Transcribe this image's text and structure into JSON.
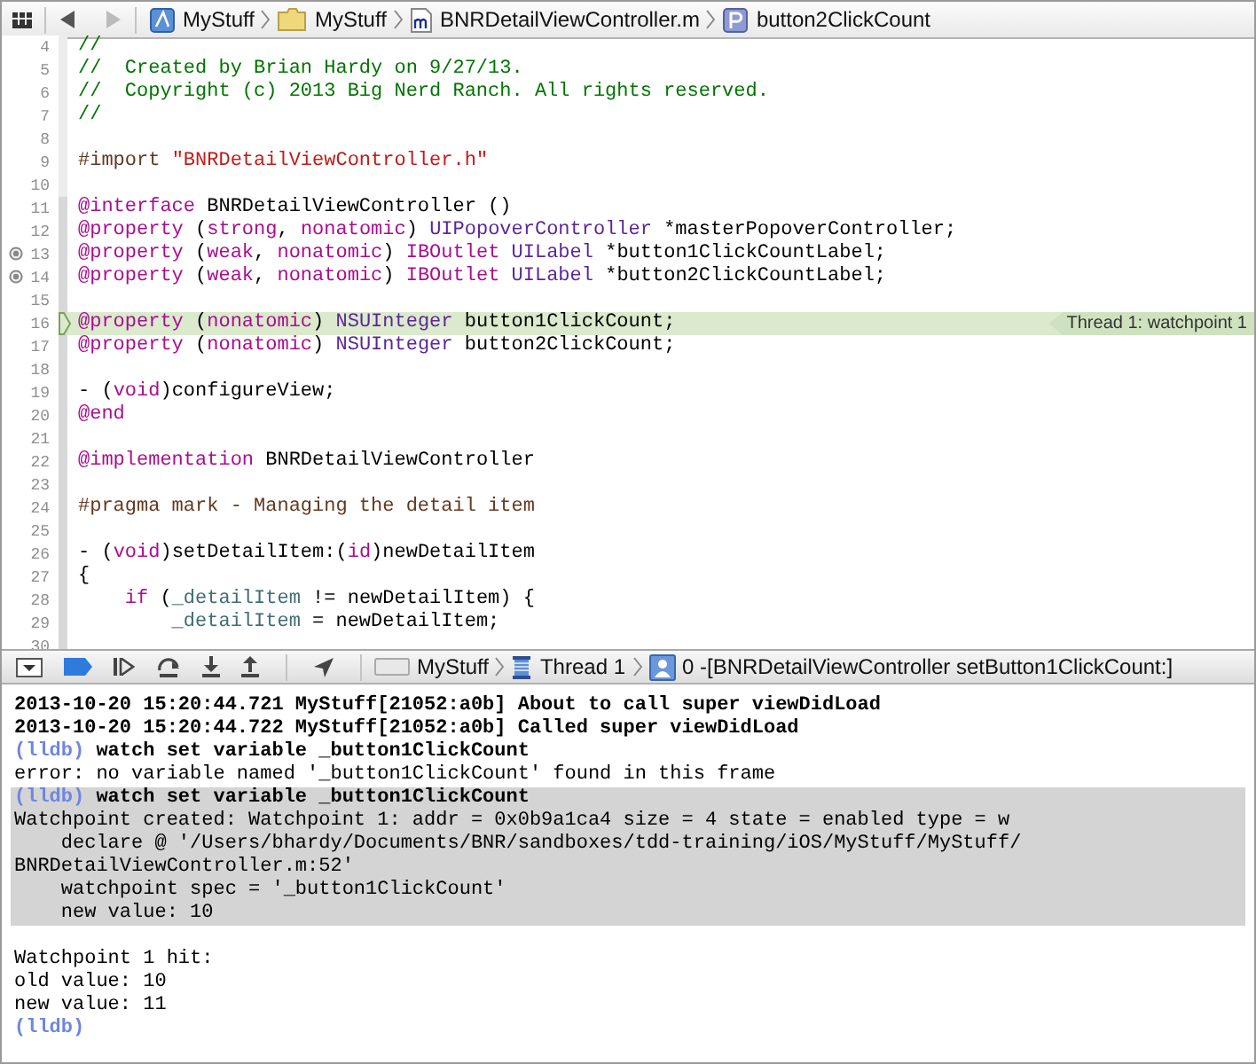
{
  "jump_bar": {
    "back_enabled": true,
    "forward_enabled": false,
    "items": [
      {
        "kind": "project",
        "label": "MyStuff"
      },
      {
        "kind": "folder",
        "label": "MyStuff"
      },
      {
        "kind": "source",
        "label": "BNRDetailViewController.m"
      },
      {
        "kind": "property",
        "label": "button2ClickCount"
      }
    ]
  },
  "editor": {
    "lines": [
      {
        "number": "4",
        "current": false,
        "outlet": false,
        "tokens": [
          {
            "kind": "comment",
            "text": "//"
          }
        ]
      },
      {
        "number": "5",
        "current": false,
        "outlet": false,
        "tokens": [
          {
            "kind": "comment",
            "text": "//  Created by Brian Hardy on 9/27/13."
          }
        ]
      },
      {
        "number": "6",
        "current": false,
        "outlet": false,
        "tokens": [
          {
            "kind": "comment",
            "text": "//  Copyright (c) 2013 Big Nerd Ranch. All rights reserved."
          }
        ]
      },
      {
        "number": "7",
        "current": false,
        "outlet": false,
        "tokens": [
          {
            "kind": "comment",
            "text": "//"
          }
        ]
      },
      {
        "number": "8",
        "current": false,
        "outlet": false
      },
      {
        "number": "9",
        "current": false,
        "outlet": false,
        "tokens": [
          {
            "kind": "preproc",
            "text": "#import "
          },
          {
            "kind": "string",
            "text": "\"BNRDetailViewController.h\""
          }
        ]
      },
      {
        "number": "10",
        "current": false,
        "outlet": false
      },
      {
        "number": "11",
        "current": false,
        "outlet": false,
        "tokens": [
          {
            "kind": "keyword",
            "text": "@interface"
          },
          {
            "kind": "plain",
            "text": " BNRDetailViewController ()"
          }
        ]
      },
      {
        "number": "12",
        "current": false,
        "outlet": false,
        "tokens": [
          {
            "kind": "keyword",
            "text": "@property"
          },
          {
            "kind": "plain",
            "text": " ("
          },
          {
            "kind": "keyword",
            "text": "strong"
          },
          {
            "kind": "plain",
            "text": ", "
          },
          {
            "kind": "keyword",
            "text": "nonatomic"
          },
          {
            "kind": "plain",
            "text": ") "
          },
          {
            "kind": "type",
            "text": "UIPopoverController"
          },
          {
            "kind": "plain",
            "text": " *masterPopoverController;"
          }
        ]
      },
      {
        "number": "13",
        "current": false,
        "outlet": true,
        "tokens": [
          {
            "kind": "keyword",
            "text": "@property"
          },
          {
            "kind": "plain",
            "text": " ("
          },
          {
            "kind": "keyword",
            "text": "weak"
          },
          {
            "kind": "plain",
            "text": ", "
          },
          {
            "kind": "keyword",
            "text": "nonatomic"
          },
          {
            "kind": "plain",
            "text": ") "
          },
          {
            "kind": "keyword",
            "text": "IBOutlet "
          },
          {
            "kind": "type",
            "text": "UILabel"
          },
          {
            "kind": "plain",
            "text": " *button1ClickCountLabel;"
          }
        ]
      },
      {
        "number": "14",
        "current": false,
        "outlet": true,
        "tokens": [
          {
            "kind": "keyword",
            "text": "@property"
          },
          {
            "kind": "plain",
            "text": " ("
          },
          {
            "kind": "keyword",
            "text": "weak"
          },
          {
            "kind": "plain",
            "text": ", "
          },
          {
            "kind": "keyword",
            "text": "nonatomic"
          },
          {
            "kind": "plain",
            "text": ") "
          },
          {
            "kind": "keyword",
            "text": "IBOutlet "
          },
          {
            "kind": "type",
            "text": "UILabel"
          },
          {
            "kind": "plain",
            "text": " *button2ClickCountLabel;"
          }
        ]
      },
      {
        "number": "15",
        "current": false,
        "outlet": false
      },
      {
        "number": "16",
        "current": true,
        "outlet": false,
        "annotation": "Thread 1: watchpoint 1",
        "tokens": [
          {
            "kind": "keyword",
            "text": "@property"
          },
          {
            "kind": "plain",
            "text": " ("
          },
          {
            "kind": "keyword",
            "text": "nonatomic"
          },
          {
            "kind": "plain",
            "text": ") "
          },
          {
            "kind": "type",
            "text": "NSUInteger"
          },
          {
            "kind": "plain",
            "text": " button1ClickCount;"
          }
        ]
      },
      {
        "number": "17",
        "current": false,
        "outlet": false,
        "tokens": [
          {
            "kind": "keyword",
            "text": "@property"
          },
          {
            "kind": "plain",
            "text": " ("
          },
          {
            "kind": "keyword",
            "text": "nonatomic"
          },
          {
            "kind": "plain",
            "text": ") "
          },
          {
            "kind": "type",
            "text": "NSUInteger"
          },
          {
            "kind": "plain",
            "text": " button2ClickCount;"
          }
        ]
      },
      {
        "number": "18",
        "current": false,
        "outlet": false
      },
      {
        "number": "19",
        "current": false,
        "outlet": false,
        "tokens": [
          {
            "kind": "plain",
            "text": "- ("
          },
          {
            "kind": "keyword",
            "text": "void"
          },
          {
            "kind": "plain",
            "text": ")configureView;"
          }
        ]
      },
      {
        "number": "20",
        "current": false,
        "outlet": false,
        "tokens": [
          {
            "kind": "keyword",
            "text": "@end"
          }
        ]
      },
      {
        "number": "21",
        "current": false,
        "outlet": false
      },
      {
        "number": "22",
        "current": false,
        "outlet": false,
        "tokens": [
          {
            "kind": "keyword",
            "text": "@implementation"
          },
          {
            "kind": "plain",
            "text": " BNRDetailViewController"
          }
        ]
      },
      {
        "number": "23",
        "current": false,
        "outlet": false
      },
      {
        "number": "24",
        "current": false,
        "outlet": false,
        "tokens": [
          {
            "kind": "preproc",
            "text": "#pragma mark - Managing the detail item"
          }
        ]
      },
      {
        "number": "25",
        "current": false,
        "outlet": false
      },
      {
        "number": "26",
        "current": false,
        "outlet": false,
        "tokens": [
          {
            "kind": "plain",
            "text": "- ("
          },
          {
            "kind": "keyword",
            "text": "void"
          },
          {
            "kind": "plain",
            "text": ")setDetailItem:("
          },
          {
            "kind": "keyword",
            "text": "id"
          },
          {
            "kind": "plain",
            "text": ")newDetailItem"
          }
        ]
      },
      {
        "number": "27",
        "current": false,
        "outlet": false,
        "tokens": [
          {
            "kind": "plain",
            "text": "{"
          }
        ]
      },
      {
        "number": "28",
        "current": false,
        "outlet": false,
        "tokens": [
          {
            "kind": "keyword",
            "text": "    if"
          },
          {
            "kind": "plain",
            "text": " ("
          },
          {
            "kind": "ivar",
            "text": "_detailItem"
          },
          {
            "kind": "plain",
            "text": " != newDetailItem) {"
          }
        ]
      },
      {
        "number": "29",
        "current": false,
        "outlet": false,
        "tokens": [
          {
            "kind": "ivar",
            "text": "        _detailItem"
          },
          {
            "kind": "plain",
            "text": " = newDetailItem;"
          }
        ]
      },
      {
        "number": "30",
        "current": false,
        "outlet": false
      }
    ]
  },
  "debug_bar": {
    "console_shown": true,
    "breakpoints_active": true,
    "path": [
      {
        "kind": "device",
        "label": "MyStuff"
      },
      {
        "kind": "thread",
        "label": "Thread 1"
      },
      {
        "kind": "frame",
        "label": "0 -[BNRDetailViewController setButton1ClickCount:]"
      }
    ]
  },
  "console": {
    "lines": [
      {
        "kind": "log",
        "highlighted": false,
        "text": "2013-10-20 15:20:44.721 MyStuff[21052:a0b] About to call super viewDidLoad"
      },
      {
        "kind": "log",
        "highlighted": false,
        "text": "2013-10-20 15:20:44.722 MyStuff[21052:a0b] Called super viewDidLoad"
      },
      {
        "kind": "command",
        "highlighted": false,
        "prompt": "(lldb)",
        "text": "watch set variable _button1ClickCount"
      },
      {
        "kind": "output",
        "highlighted": false,
        "text": "error: no variable named '_button1ClickCount' found in this frame"
      },
      {
        "kind": "command",
        "highlighted": true,
        "prompt": "(lldb)",
        "text": "watch set variable _button1ClickCount"
      },
      {
        "kind": "output",
        "highlighted": true,
        "text": "Watchpoint created: Watchpoint 1: addr = 0x0b9a1ca4 size = 4 state = enabled type = w"
      },
      {
        "kind": "output",
        "highlighted": true,
        "text": "    declare @ '/Users/bhardy/Documents/BNR/sandboxes/tdd-training/iOS/MyStuff/MyStuff/"
      },
      {
        "kind": "output",
        "highlighted": true,
        "text": "BNRDetailViewController.m:52'"
      },
      {
        "kind": "output",
        "highlighted": true,
        "text": "    watchpoint spec = '_button1ClickCount'"
      },
      {
        "kind": "output",
        "highlighted": true,
        "text": "    new value: 10"
      },
      {
        "kind": "blank",
        "highlighted": false
      },
      {
        "kind": "output",
        "highlighted": false,
        "text": "Watchpoint 1 hit:"
      },
      {
        "kind": "output",
        "highlighted": false,
        "text": "old value: 10"
      },
      {
        "kind": "output",
        "highlighted": false,
        "text": "new value: 11"
      },
      {
        "kind": "command",
        "highlighted": false,
        "prompt": "(lldb)"
      }
    ]
  }
}
